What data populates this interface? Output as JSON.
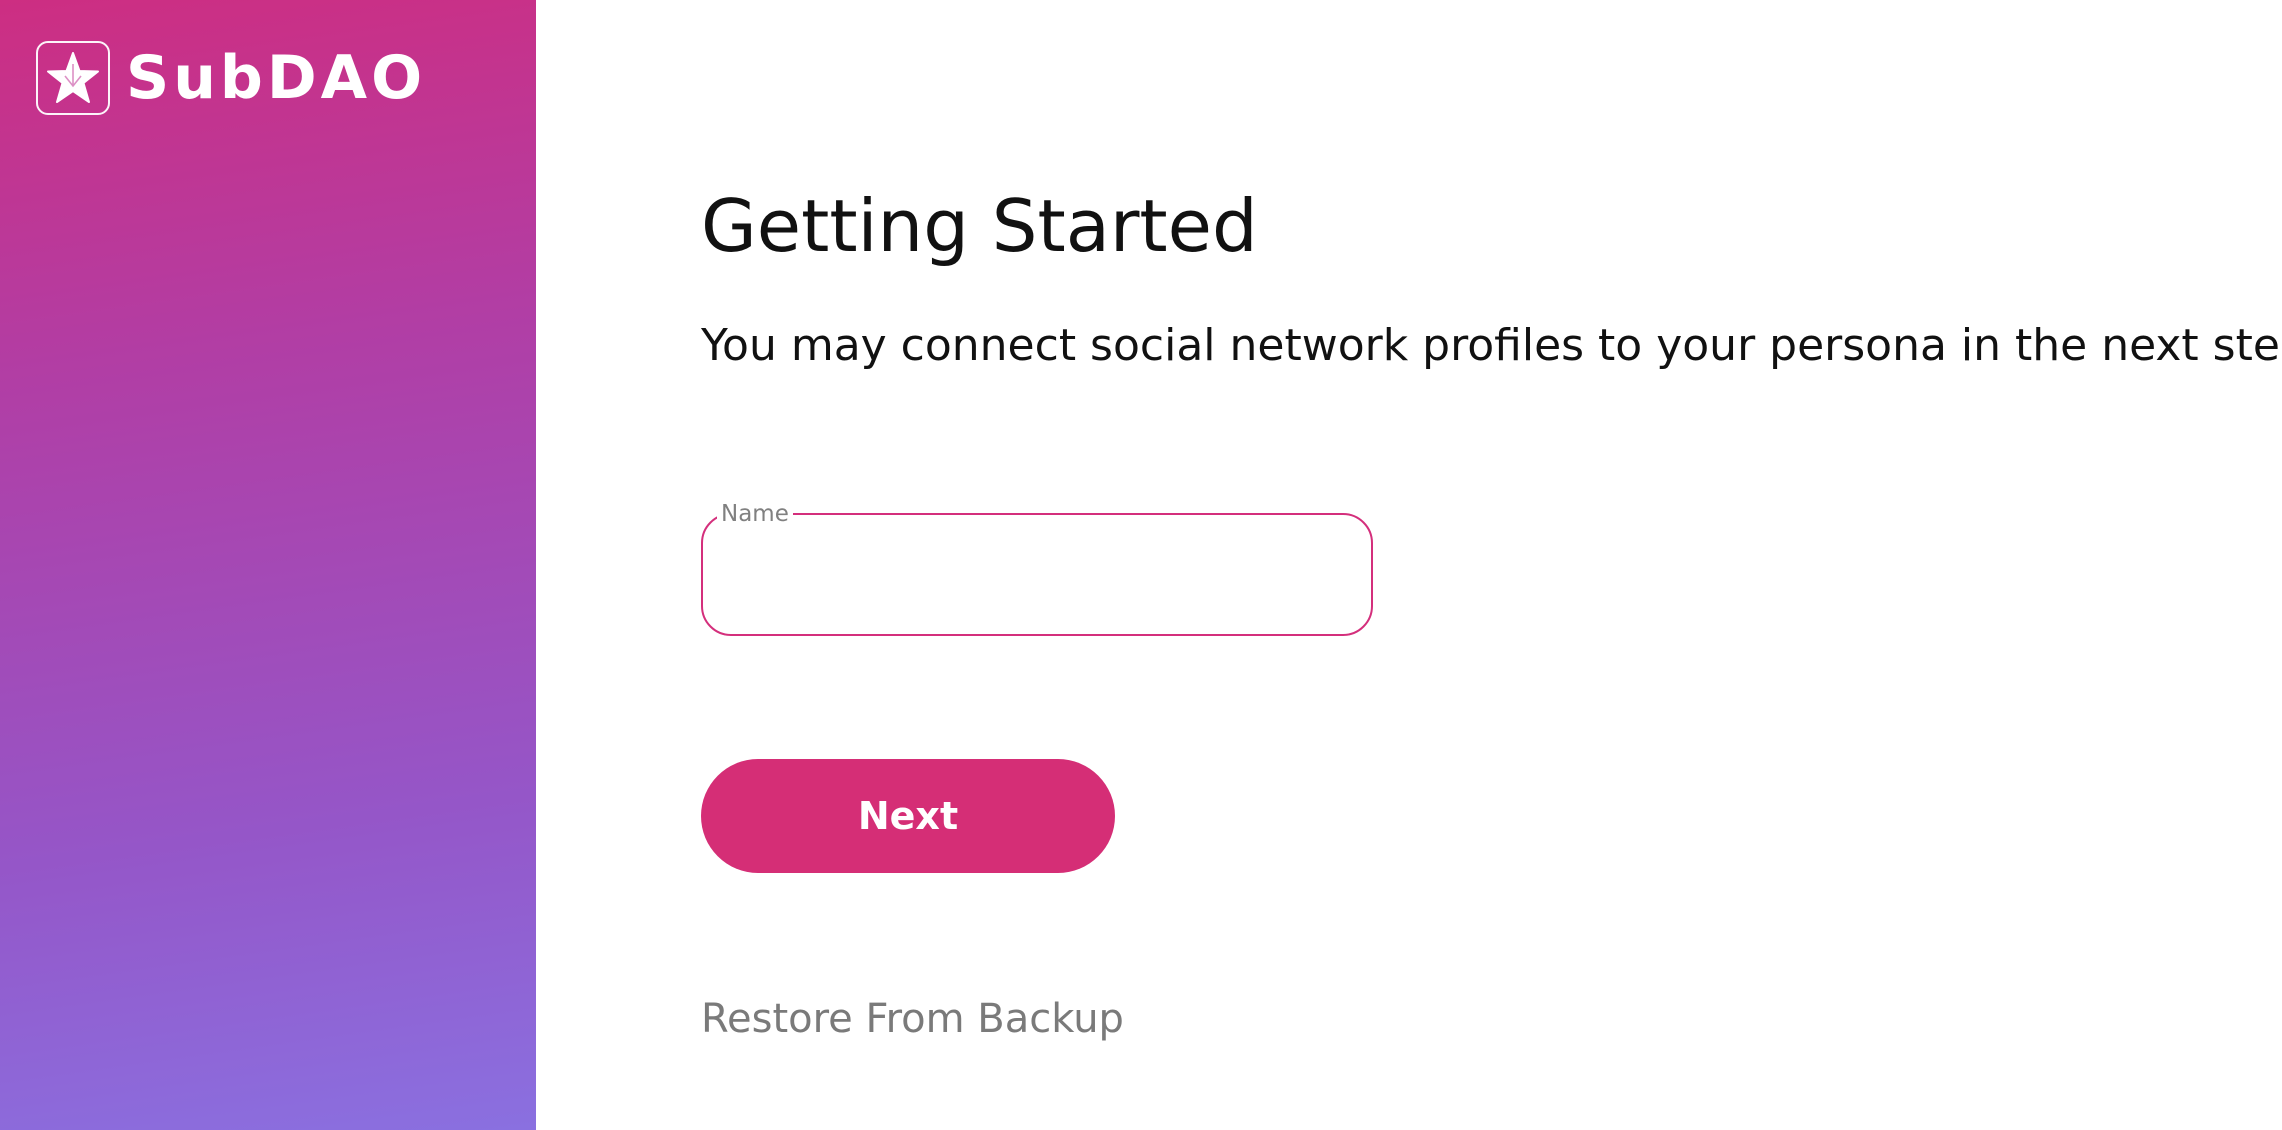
{
  "brand": {
    "name": "SubDAO",
    "logo_icon": "star-icon"
  },
  "main": {
    "title": "Getting Started",
    "subtitle": "You may connect social network profiles to your persona in the next step.",
    "name_field": {
      "label": "Name",
      "value": "",
      "placeholder": ""
    },
    "next_label": "Next",
    "restore_label": "Restore From Backup"
  },
  "colors": {
    "sidebar_gradient_start": "#cd2e82",
    "sidebar_gradient_end": "#8a70e0",
    "accent": "#d52e76",
    "field_border": "#d42f7c",
    "muted_text": "#7a7a7a"
  }
}
